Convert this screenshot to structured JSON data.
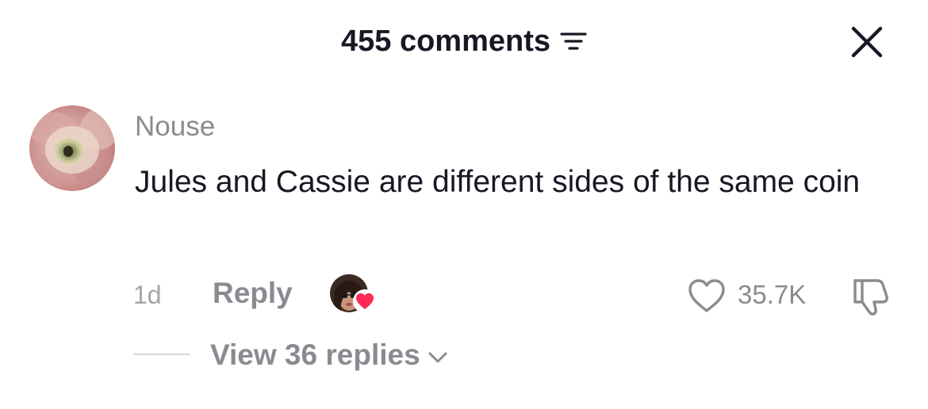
{
  "header": {
    "title": "455 comments",
    "sort_icon": "sort-lines-icon",
    "close_icon": "close-x-icon"
  },
  "comment": {
    "username": "Nouse",
    "text": "Jules and Cassie are different sides of the same coin",
    "time": "1d",
    "reply_label": "Reply",
    "like_count": "35.7K",
    "creator_liked": true
  },
  "replies": {
    "label": "View 36 replies"
  },
  "colors": {
    "primary_text": "#161823",
    "secondary_text": "#8a8b91",
    "heart_accent": "#fe2c55"
  }
}
